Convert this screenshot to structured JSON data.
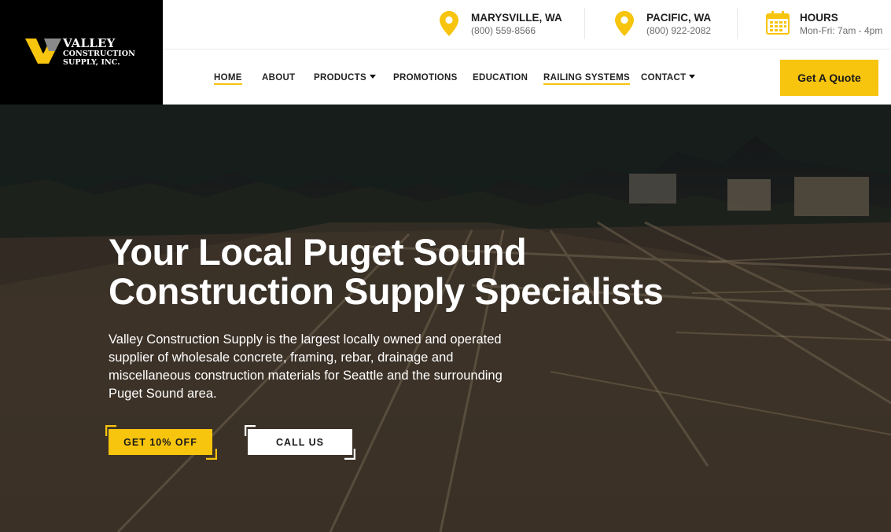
{
  "brand": {
    "logo_line1": "VALLEY",
    "logo_line2": "CONSTRUCTION",
    "logo_line3": "SUPPLY, INC.",
    "colors": {
      "accent": "#f7c40e",
      "dark": "#000000",
      "text": "#222222"
    }
  },
  "contact_info": [
    {
      "icon": "map-pin-icon",
      "title": "MARYSVILLE, WA",
      "sub": "(800) 559-8566"
    },
    {
      "icon": "map-pin-icon",
      "title": "PACIFIC, WA",
      "sub": "(800) 922-2082"
    },
    {
      "icon": "calendar-icon",
      "title": "HOURS",
      "sub": "Mon-Fri: 7am - 4pm"
    }
  ],
  "nav": {
    "items": [
      {
        "label": "HOME"
      },
      {
        "label": "ABOUT"
      },
      {
        "label": "PRODUCTS"
      },
      {
        "label": "PROMOTIONS"
      },
      {
        "label": "EDUCATION"
      },
      {
        "label": "RAILING SYSTEMS"
      },
      {
        "label": "CONTACT"
      }
    ],
    "quote_button": "Get A Quote"
  },
  "hero": {
    "title_line1": "Your Local Puget Sound",
    "title_line2": "Construction Supply Specialists",
    "description": "Valley Construction Supply is the largest locally owned and operated supplier of wholesale concrete, framing, rebar, drainage and miscellaneous construction materials for Seattle and the surrounding Puget Sound area.",
    "cta_primary": "GET 10% OFF",
    "cta_secondary": "CALL US"
  }
}
